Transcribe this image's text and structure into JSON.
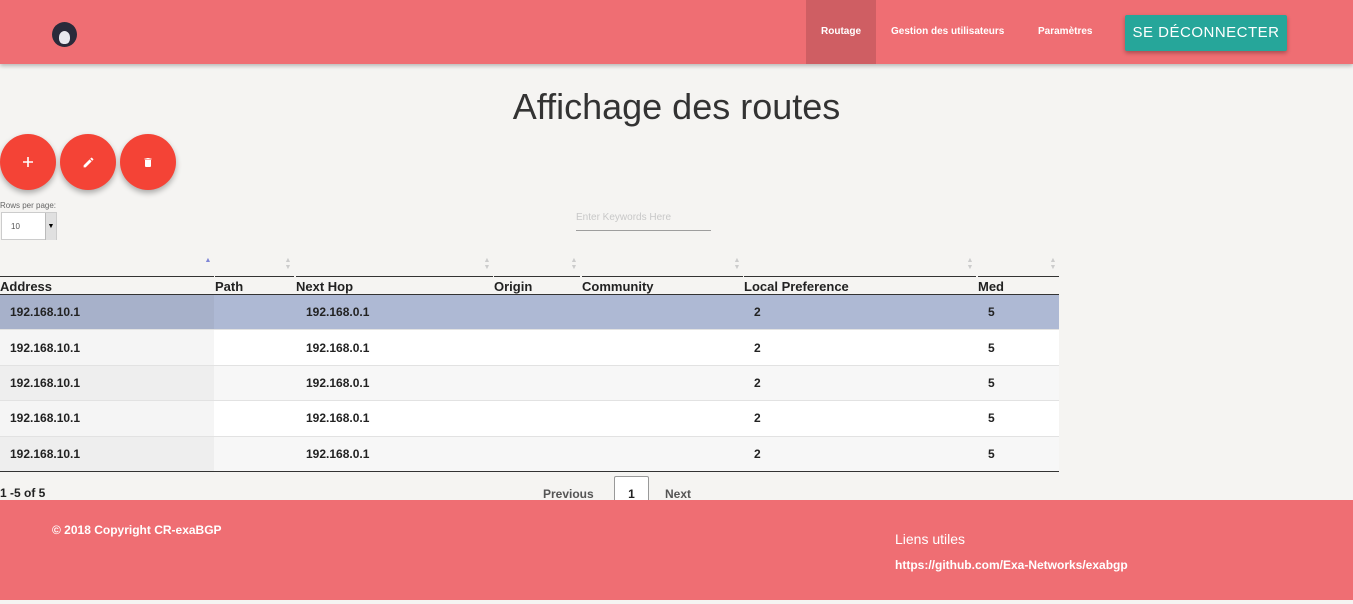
{
  "navbar": {
    "items": [
      {
        "label": "Routage"
      },
      {
        "label": "Gestion des utilisateurs"
      },
      {
        "label": "Paramètres"
      }
    ],
    "logout_label": "SE DÉCONNECTER",
    "accent_color": "#ef6e73",
    "logout_color": "#26a69a"
  },
  "main": {
    "title": "Affichage des routes",
    "actions": [
      {
        "icon": "plus-icon",
        "glyph": "+"
      },
      {
        "icon": "pencil-icon",
        "glyph": "✎"
      },
      {
        "icon": "trash-icon",
        "glyph": "🗑"
      }
    ],
    "fab_color": "#f44336"
  },
  "table_controls": {
    "rows_per_page_label": "Rows per page:",
    "rows_per_page_value": "10",
    "search_placeholder": "Enter Keywords Here"
  },
  "table": {
    "columns": [
      "Address",
      "Path",
      "Next Hop",
      "Origin",
      "Community",
      "Local Preference",
      "Med"
    ],
    "rows": [
      [
        "192.168.10.1",
        "",
        "192.168.0.1",
        "",
        "",
        "2",
        "5"
      ],
      [
        "192.168.10.1",
        "",
        "192.168.0.1",
        "",
        "",
        "2",
        "5"
      ],
      [
        "192.168.10.1",
        "",
        "192.168.0.1",
        "",
        "",
        "2",
        "5"
      ],
      [
        "192.168.10.1",
        "",
        "192.168.0.1",
        "",
        "",
        "2",
        "5"
      ],
      [
        "192.168.10.1",
        "",
        "192.168.0.1",
        "",
        "",
        "2",
        "5"
      ]
    ]
  },
  "pagination": {
    "info": "1 -5 of 5",
    "previous_label": "Previous",
    "current_page": "1",
    "next_label": "Next"
  },
  "footer": {
    "copyright": "© 2018 Copyright CR-exaBGP",
    "links_title": "Liens utiles",
    "link": "https://github.com/Exa-Networks/exabgp"
  }
}
